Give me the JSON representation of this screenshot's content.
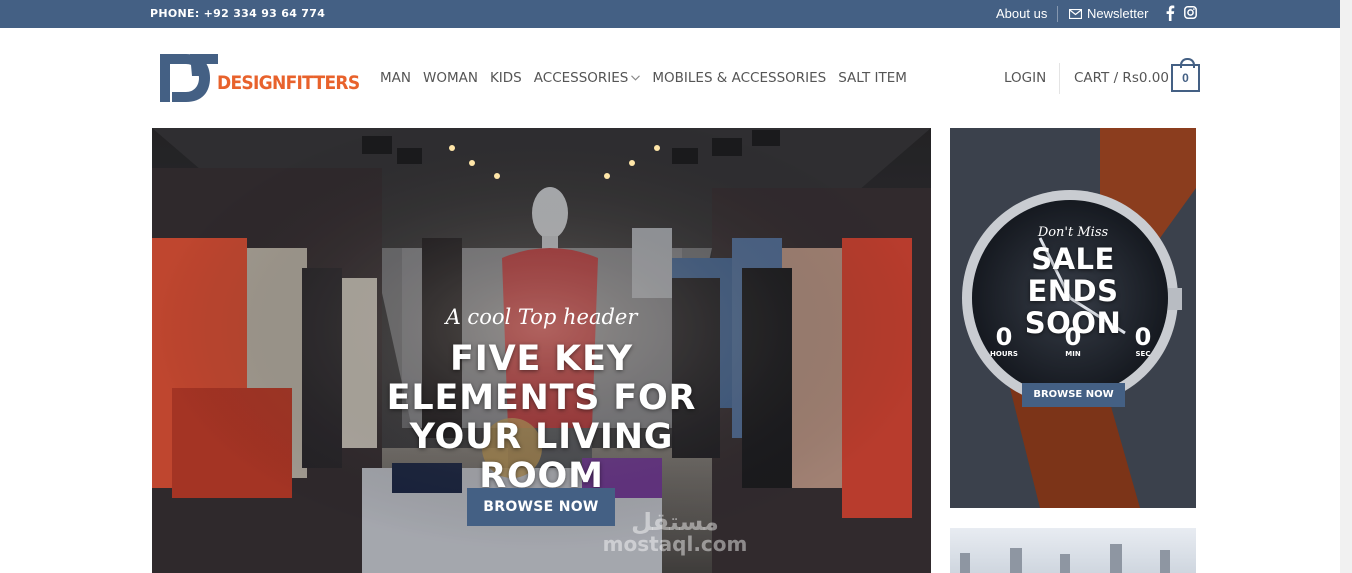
{
  "topbar": {
    "phone": "PHONE: +92 334 93 64 774",
    "about": "About us",
    "newsletter": "Newsletter",
    "social": [
      "facebook-icon",
      "instagram-icon"
    ],
    "bg_color": "#446084"
  },
  "header": {
    "logo_text": "DESIGNFITTERS",
    "nav": [
      {
        "label": "MAN"
      },
      {
        "label": "WOMAN"
      },
      {
        "label": "KIDS"
      },
      {
        "label": "ACCESSORIES"
      },
      {
        "label": "MOBILES & ACCESSORIES"
      },
      {
        "label": "SALT ITEM"
      }
    ],
    "login": "LOGIN",
    "cart": "CART / Rs0.00",
    "cart_count": "0"
  },
  "hero": {
    "subtitle": "A cool Top header",
    "title": "FIVE KEY ELEMENTS FOR YOUR LIVING ROOM",
    "button": "BROWSE NOW"
  },
  "side_banner": {
    "kicker": "Don't Miss",
    "title": "SALE ENDS SOON",
    "countdown": [
      {
        "value": "0",
        "label": "HOURS"
      },
      {
        "value": "0",
        "label": "MIN"
      },
      {
        "value": "0",
        "label": "SEC"
      }
    ],
    "button": "BROWSE NOW"
  },
  "watermark": {
    "arabic": "مستقل",
    "latin": "mostaql.com"
  },
  "colors": {
    "primary": "#446084",
    "logo_accent": "#e8622c"
  }
}
